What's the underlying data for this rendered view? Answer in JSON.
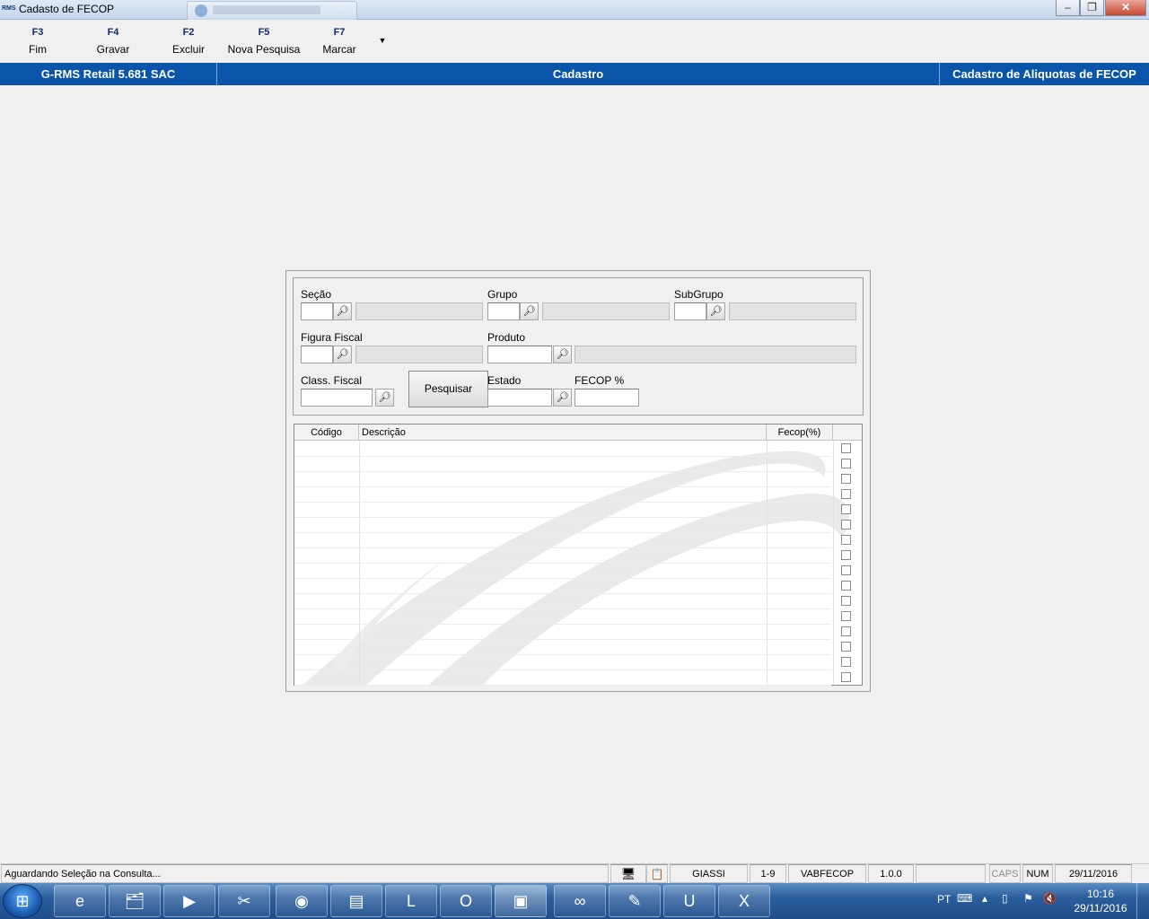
{
  "window": {
    "app_icon": "RMS",
    "title": "Cadasto de FECOP",
    "background_tab_icon": "ie-icon",
    "controls": {
      "minimize": "‒",
      "restore": "❐",
      "close": "✕"
    }
  },
  "toolbar": {
    "buttons": [
      {
        "key": "F3",
        "label": "Fim"
      },
      {
        "key": "F4",
        "label": "Gravar"
      },
      {
        "key": "F2",
        "label": "Excluir"
      },
      {
        "key": "F5",
        "label": "Nova Pesquisa"
      },
      {
        "key": "F7",
        "label": "Marcar"
      }
    ],
    "more_icon": "▼"
  },
  "header_bar": {
    "app": "G-RMS Retail 5.681 SAC",
    "module": "Cadastro",
    "screen": "Cadastro de Aliquotas de FECOP",
    "color": "#0a55aa"
  },
  "filters": {
    "secao": {
      "label": "Seção",
      "value": "",
      "description": ""
    },
    "grupo": {
      "label": "Grupo",
      "value": "",
      "description": ""
    },
    "subgrupo": {
      "label": "SubGrupo",
      "value": "",
      "description": ""
    },
    "figura_fiscal": {
      "label": "Figura Fiscal",
      "value": "",
      "description": ""
    },
    "produto": {
      "label": "Produto",
      "value": "",
      "description": ""
    },
    "class_fiscal": {
      "label": "Class. Fiscal",
      "value": ""
    },
    "pesquisar": {
      "label": "Pesquisar"
    },
    "estado": {
      "label": "Estado",
      "value": ""
    },
    "fecop": {
      "label": "FECOP %",
      "value": ""
    },
    "search_icon": "binoculars-icon"
  },
  "grid": {
    "columns": [
      "Código",
      "Descrição",
      "Fecop(%)",
      ""
    ],
    "rows": 16
  },
  "statusbar": {
    "message": "Aguardando Seleção na Consulta...",
    "user": "GIASSI",
    "range": "1-9",
    "program": "VABFECOP",
    "version": "1.0.0",
    "caps": "CAPS",
    "num": "NUM",
    "date": "29/11/2016"
  },
  "taskbar": {
    "apps": [
      "ie-icon",
      "explorer-icon",
      "media-player-icon",
      "snipping-tool-icon",
      "chrome-icon",
      "database-tool-icon",
      "lync-icon",
      "outlook-icon",
      "grms-icon",
      "visual-studio-icon",
      "notepad-plus-plus-icon",
      "ultraedit-icon",
      "excel-icon"
    ],
    "language": "PT",
    "time": "10:16",
    "date": "29/11/2016"
  }
}
